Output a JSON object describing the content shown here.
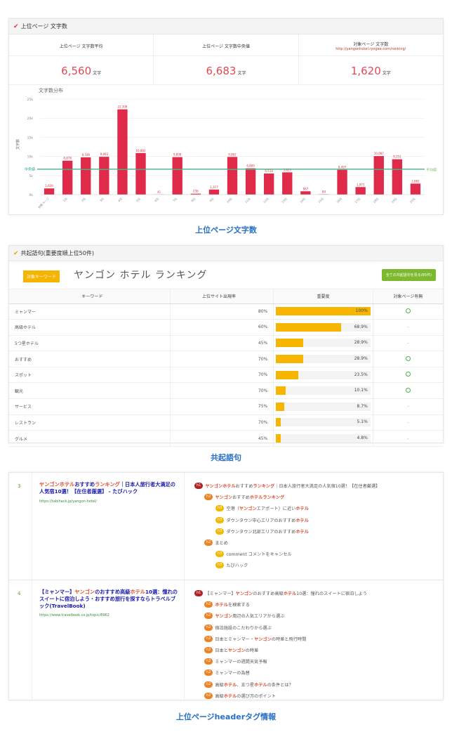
{
  "word_count": {
    "header": "上位ページ 文字数",
    "stats": [
      {
        "label": "上位ページ 文字数平均",
        "url": "",
        "value": "6,560",
        "unit": "文字"
      },
      {
        "label": "上位ページ 文字数中央値",
        "url": "",
        "value": "6,683",
        "unit": "文字"
      },
      {
        "label": "対象ページ 文字数",
        "url": "http://yangonhotel.ryogae.com/ranking/",
        "value": "1,620",
        "unit": "文字"
      }
    ],
    "caption": "上位ページ文字数"
  },
  "chart_data": {
    "type": "bar",
    "title": "文字数分布",
    "ylabel": "文字数",
    "ylim": [
      0,
      25000
    ],
    "y_ticks": [
      "0k",
      "5k",
      "10k",
      "15k",
      "20k",
      "25k"
    ],
    "categories": [
      "対象ページ",
      "1位",
      "2位",
      "3位",
      "4位",
      "5位",
      "6位",
      "7位",
      "8位",
      "9位",
      "10位",
      "11位",
      "12位",
      "13位",
      "14位",
      "15位",
      "16位",
      "17位",
      "18位",
      "19位",
      "20位"
    ],
    "values": [
      1620,
      8878,
      9749,
      9893,
      22308,
      10882,
      41,
      9808,
      236,
      1317,
      9862,
      6869,
      5514,
      5823,
      867,
      84,
      6497,
      1971,
      10087,
      9251,
      2881
    ],
    "value_labels": [
      "1,620",
      "8,878",
      "9,749",
      "9,893",
      "22,308",
      "10,882",
      "41",
      "9,808",
      "236",
      "1,317",
      "9,862",
      "6,869",
      "5,514",
      "5,823",
      "867",
      "84",
      "6,497",
      "1,971",
      "10,087",
      "9,251",
      "2,881"
    ],
    "reference_lines": [
      {
        "name": "中央値",
        "value": 6683,
        "color": "#1aa59a"
      },
      {
        "name": "平均値",
        "value": 6560,
        "color": "#7cc06a"
      }
    ],
    "bar_color": "#e02a4a",
    "grid": true
  },
  "cooccurrence": {
    "header": "共起語句(重要度順上位50件)",
    "badge": "対象キーワード",
    "keyword": "ヤンゴン ホテル ランキング",
    "button": "全ての共起語句を見る(85件)",
    "columns": [
      "キーワード",
      "上位サイト出現率",
      "重要度",
      "対象ページ有無"
    ],
    "rows": [
      {
        "kw": "ミャンマー",
        "rate": "80%",
        "imp": 100,
        "imp_label": "100%",
        "present": true
      },
      {
        "kw": "高級ホテル",
        "rate": "60%",
        "imp": 68.9,
        "imp_label": "68.9%",
        "present": false
      },
      {
        "kw": "5つ星ホテル",
        "rate": "45%",
        "imp": 28.9,
        "imp_label": "28.9%",
        "present": false
      },
      {
        "kw": "おすすめ",
        "rate": "70%",
        "imp": 28.9,
        "imp_label": "28.9%",
        "present": true
      },
      {
        "kw": "スポット",
        "rate": "70%",
        "imp": 23.5,
        "imp_label": "23.5%",
        "present": true
      },
      {
        "kw": "観光",
        "rate": "70%",
        "imp": 10.1,
        "imp_label": "10.1%",
        "present": true
      },
      {
        "kw": "サービス",
        "rate": "75%",
        "imp": 8.7,
        "imp_label": "8.7%",
        "present": false
      },
      {
        "kw": "レストラン",
        "rate": "70%",
        "imp": 5.1,
        "imp_label": "5.1%",
        "present": false
      },
      {
        "kw": "グルメ",
        "rate": "45%",
        "imp": 4.8,
        "imp_label": "4.8%",
        "present": false
      }
    ],
    "absent_mark": "-",
    "caption": "共起語句"
  },
  "headers": {
    "caption": "上位ページheaderタグ情報",
    "rows": [
      {
        "num": "3",
        "title": [
          [
            "ヤンゴンホテル",
            true
          ],
          [
            "おすすめ",
            false
          ],
          [
            "ランキング",
            true
          ],
          [
            "｜日本人旅行者大満足の人気宿10選！【在住者厳選】 - たびハック",
            false
          ]
        ],
        "url": "https://tabihack.jp/yangon-hotel/",
        "tags": [
          {
            "level": "h1",
            "parts": [
              [
                "ヤンゴンホテル",
                true
              ],
              [
                "おすすめ",
                false
              ],
              [
                "ランキング",
                true
              ],
              [
                "｜日本人旅行者大満足の人気宿10選！【在住者厳選】",
                false
              ]
            ]
          },
          {
            "level": "h2",
            "parts": [
              [
                "ヤンゴン",
                true
              ],
              [
                "おすすめ",
                false
              ],
              [
                "ホテルランキング",
                true
              ]
            ]
          },
          {
            "level": "h3",
            "parts": [
              [
                "空港（",
                false
              ],
              [
                "ヤンゴン",
                true
              ],
              [
                "エアポート）に近い",
                false
              ],
              [
                "ホテル",
                true
              ]
            ]
          },
          {
            "level": "h3",
            "parts": [
              [
                "ダウンタウン中心エリアのおすすめ",
                false
              ],
              [
                "ホテル",
                true
              ]
            ]
          },
          {
            "level": "h3",
            "parts": [
              [
                "ダウンタウン北部エリアのおすすめ",
                false
              ],
              [
                "ホテル",
                true
              ]
            ]
          },
          {
            "level": "h2",
            "parts": [
              [
                "まとめ",
                false
              ]
            ]
          },
          {
            "level": "h3",
            "parts": [
              [
                "comment コメントをキャンセル",
                false
              ]
            ]
          },
          {
            "level": "h3",
            "parts": [
              [
                "たびハック",
                false
              ]
            ]
          }
        ]
      },
      {
        "num": "4",
        "title": [
          [
            "【ミャンマー】",
            false
          ],
          [
            "ヤンゴン",
            true
          ],
          [
            "のおすすめ高級",
            false
          ],
          [
            "ホテル",
            true
          ],
          [
            "10選：憧れのスイートに宿泊しよう・おすすめ旅行を探すならトラベルブック(TravelBook)",
            false
          ]
        ],
        "url": "https://www.travelbook.co.jp/topic/8962",
        "tags": [
          {
            "level": "h1",
            "parts": [
              [
                "【ミャンマー】",
                false
              ],
              [
                "ヤンゴン",
                true
              ],
              [
                "のおすすめ高級",
                false
              ],
              [
                "ホテル",
                true
              ],
              [
                "10選：憧れのスイートに宿泊しよう",
                false
              ]
            ]
          },
          {
            "level": "h2",
            "parts": [
              [
                "ホテル",
                true
              ],
              [
                "を検索する",
                false
              ]
            ]
          },
          {
            "level": "h2",
            "parts": [
              [
                "ヤンゴン",
                true
              ],
              [
                "周辺の人気エリアから選ぶ",
                false
              ]
            ]
          },
          {
            "level": "h2",
            "parts": [
              [
                "宿泊施設のこだわりから選ぶ",
                false
              ]
            ]
          },
          {
            "level": "h2",
            "parts": [
              [
                "日本とミャンマー・",
                false
              ],
              [
                "ヤンゴン",
                true
              ],
              [
                "の時差と飛行時間",
                false
              ]
            ]
          },
          {
            "level": "h2",
            "parts": [
              [
                "日本と",
                false
              ],
              [
                "ヤンゴン",
                true
              ],
              [
                "の時差",
                false
              ]
            ]
          },
          {
            "level": "h2",
            "parts": [
              [
                "ミャンマーの週間天気予報",
                false
              ]
            ]
          },
          {
            "level": "h2",
            "parts": [
              [
                "ミャンマーの為替",
                false
              ]
            ]
          },
          {
            "level": "h2",
            "parts": [
              [
                "高級",
                false
              ],
              [
                "ホテル",
                true
              ],
              [
                "、五つ星",
                false
              ],
              [
                "ホテル",
                true
              ],
              [
                "の条件とは？",
                false
              ]
            ]
          },
          {
            "level": "h2",
            "parts": [
              [
                "高級",
                false
              ],
              [
                "ホテル",
                true
              ],
              [
                "の選び方のポイント",
                false
              ]
            ]
          }
        ]
      }
    ]
  }
}
